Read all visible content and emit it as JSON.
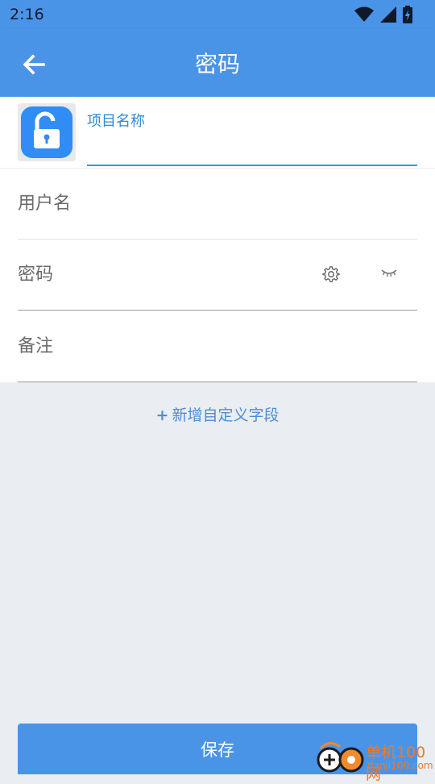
{
  "status_bar": {
    "time": "2:16",
    "icons": [
      "wifi-icon",
      "cell-signal-icon",
      "battery-charging-icon"
    ]
  },
  "app_bar": {
    "title": "密码",
    "back_icon": "arrow-left-icon",
    "color": "#4a94e8"
  },
  "form": {
    "item_icon": "unlock-icon",
    "project_name": {
      "label": "项目名称",
      "value": ""
    },
    "username": {
      "placeholder": "用户名",
      "value": ""
    },
    "password": {
      "placeholder": "密码",
      "value": "",
      "settings_icon": "gear-icon",
      "visibility_icon": "eye-closed-icon"
    },
    "note": {
      "placeholder": "备注",
      "value": ""
    }
  },
  "add_custom_field": {
    "plus": "+",
    "label": "新增自定义字段"
  },
  "save_button": {
    "label": "保存"
  },
  "watermark": {
    "title": "单机100网",
    "url": "danji100.com"
  }
}
